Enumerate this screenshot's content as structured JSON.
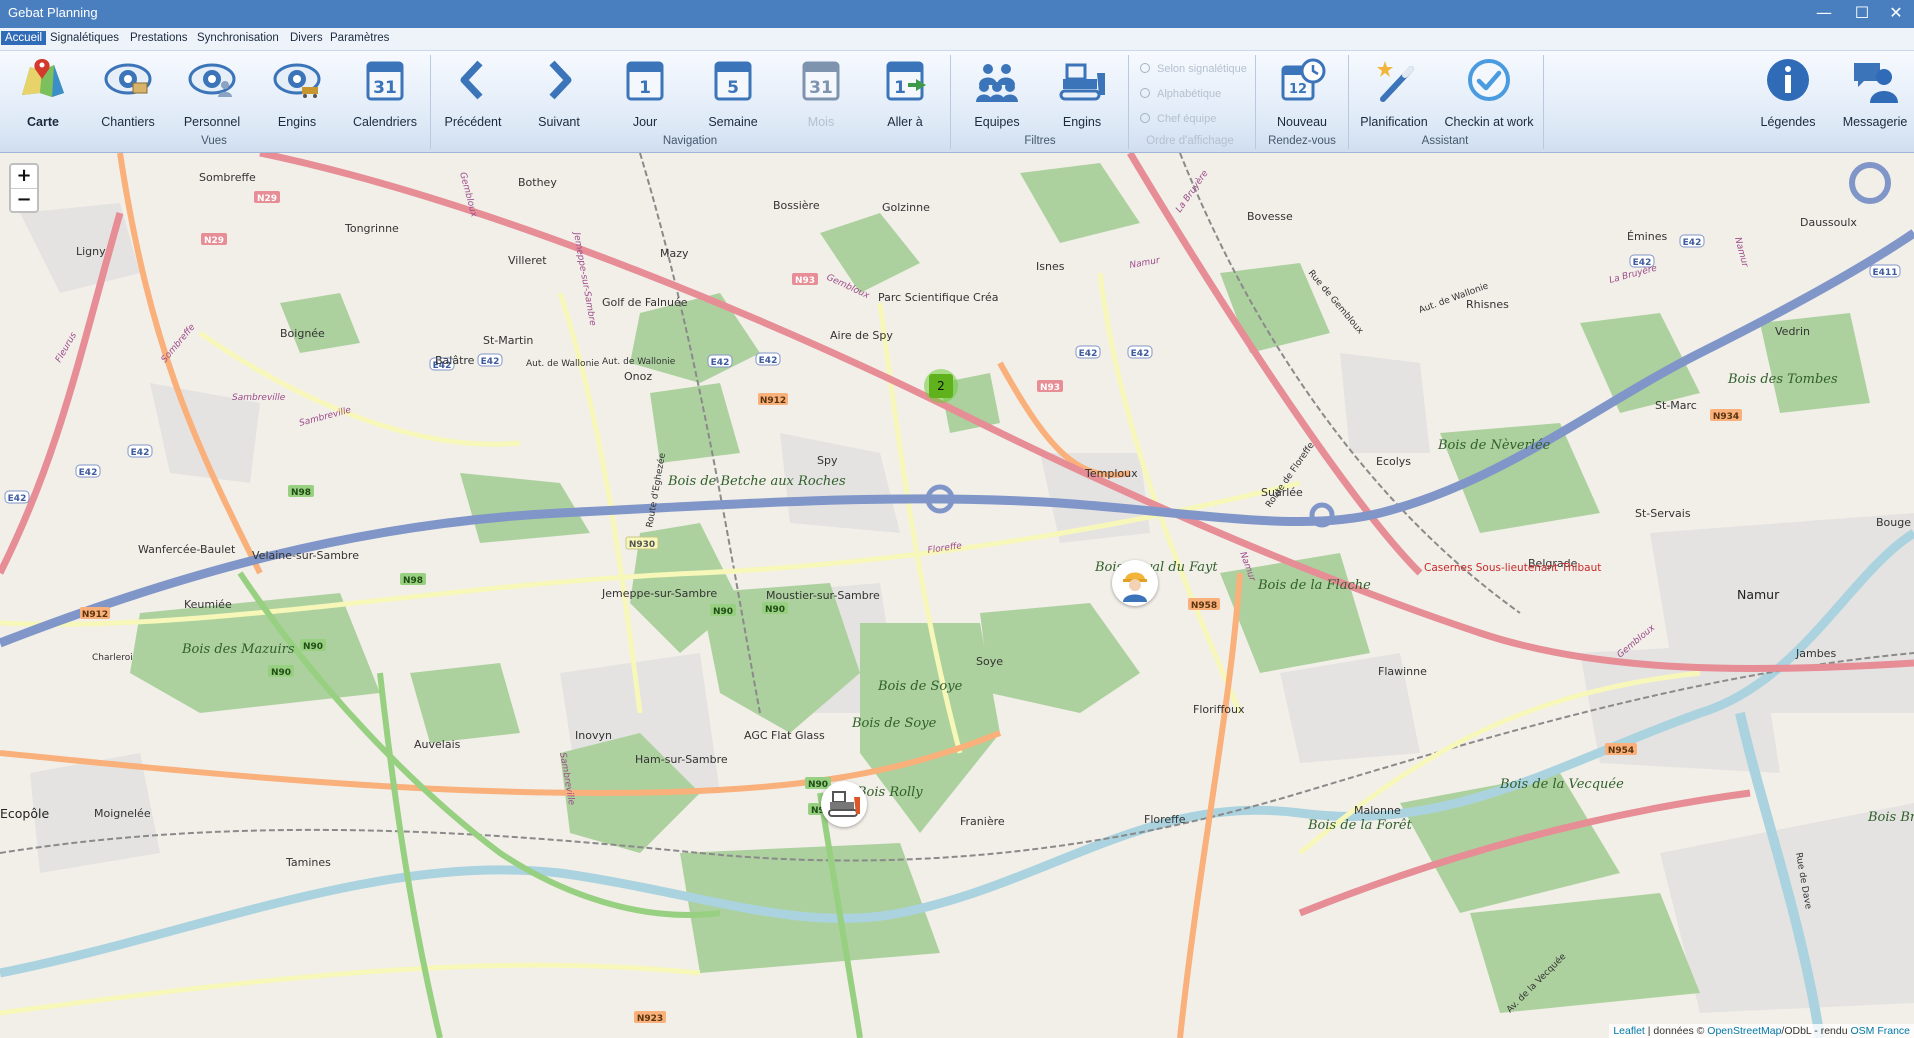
{
  "window": {
    "title": "Gebat Planning",
    "controls": {
      "minimize": "—",
      "maximize": "☐",
      "close": "✕"
    }
  },
  "menu": [
    "Accueil",
    "Signalétiques",
    "Prestations",
    "Synchronisation",
    "Divers",
    "Paramètres"
  ],
  "ribbon": {
    "vues": {
      "label": "Vues",
      "buttons": [
        "Carte",
        "Chantiers",
        "Personnel",
        "Engins",
        "Calendriers"
      ]
    },
    "navigation": {
      "label": "Navigation",
      "buttons": [
        "Précédent",
        "Suivant",
        "Jour",
        "Semaine",
        "Mois",
        "Aller à"
      ]
    },
    "filtres": {
      "label": "Filtres",
      "buttons": [
        "Equipes",
        "Engins"
      ]
    },
    "ordre": {
      "label": "Ordre d'affichage",
      "options": [
        "Selon signalétique",
        "Alphabétique",
        "Chef équipe"
      ]
    },
    "rendezvous": {
      "label": "Rendez-vous",
      "buttons": [
        "Nouveau"
      ]
    },
    "assistant": {
      "label": "Assistant",
      "buttons": [
        "Planification",
        "Checkin at work"
      ]
    },
    "right": {
      "buttons": [
        "Légendes",
        "Messagerie"
      ]
    },
    "calendar_numbers": {
      "calendriers": "31",
      "jour": "1",
      "semaine": "5",
      "mois": "31",
      "aller": "1",
      "nouveau": "12"
    }
  },
  "map": {
    "zoom": {
      "in": "+",
      "out": "−"
    },
    "cluster_count": "2",
    "places": [
      "Sombreffe",
      "Bothey",
      "Bossière",
      "Golzinne",
      "Bovesse",
      "Émines",
      "Daussoulx",
      "Ligny",
      "Tongrinne",
      "Mazy",
      "Isnes",
      "Rhisnes",
      "Villeret",
      "Golf de Falnuée",
      "Parc Scientifique Créa",
      "Vedrin",
      "Boignée",
      "St-Martin",
      "Balâtre",
      "Onoz",
      "St-Marc",
      "Spy",
      "Temploux",
      "Suarlée",
      "Ecolys",
      "St-Servais",
      "Bouge",
      "Wanfercée-Baulet",
      "Velaine-sur-Sambre",
      "Keumiée",
      "Jemeppe-sur-Sambre",
      "Moustier-sur-Sambre",
      "Belgrade",
      "Namur",
      "Soye",
      "Flawinne",
      "Jambes",
      "Auvelais",
      "Ham-sur-Sambre",
      "Floriffoux",
      "Moignelée",
      "Franière",
      "Floreffe",
      "Malonne",
      "Tamines",
      "Ecopôle",
      "AGC Flat Glass",
      "Inovyn",
      "Aire de Spy"
    ],
    "forests": [
      "Bois de Betche aux Roches",
      "Bois Royal du Fayt",
      "Bois de la Flache",
      "Bois de Nèverlée",
      "Bois des Mazuirs",
      "Bois de Soye",
      "Bois de Soye",
      "Bois Rolly",
      "Bois de la Vecquée",
      "Bois de la Forêt",
      "Bois des Tombes",
      "Bois Br"
    ],
    "red_labels": [
      "Casernes Sous-lieutenant Thibaut"
    ],
    "road_shields": [
      "N29",
      "N29",
      "N93",
      "N93",
      "E42",
      "E42",
      "E42",
      "E42",
      "E42",
      "E42",
      "E42",
      "E42",
      "E42",
      "E42",
      "E42",
      "E411",
      "N912",
      "N912",
      "N98",
      "N98",
      "N930",
      "N90",
      "N90",
      "N90",
      "N90",
      "N90",
      "N90",
      "N934",
      "N958",
      "N954",
      "N923"
    ],
    "road_names": [
      "Aut. de Wallonie",
      "Aut. de Wallonie",
      "Aut. de Wallonie",
      "Gembloux",
      "La Bruyère",
      "La Bruyère",
      "Namur",
      "Namur",
      "Sambreville",
      "Sambreville",
      "Floreffe",
      "Fleurus",
      "Sombreffe",
      "Jemeppe-sur-Sambre",
      "Gembloux",
      "Rue de Gembloux",
      "Route de Floreffe",
      "Route d'Eghezée",
      "Charleroi",
      "Rue de Dave",
      "Av. de la Vecquée",
      "Namur",
      "Sambreville",
      "Gembloux"
    ],
    "attribution": {
      "leaflet": "Leaflet",
      "sep1": " | données © ",
      "osm": "OpenStreetMap",
      "mid": "/ODbL - rendu ",
      "osmfr": "OSM France"
    }
  },
  "colors": {
    "titlebar": "#4a7fbf",
    "ribbon_icon": "#3b74b8",
    "forest": "#add19e",
    "motorway": "#8196c8",
    "trunk": "#e68d96",
    "primary": "#f9b07a",
    "secondary": "#f7f7b9",
    "cluster": "#5fb21c"
  }
}
